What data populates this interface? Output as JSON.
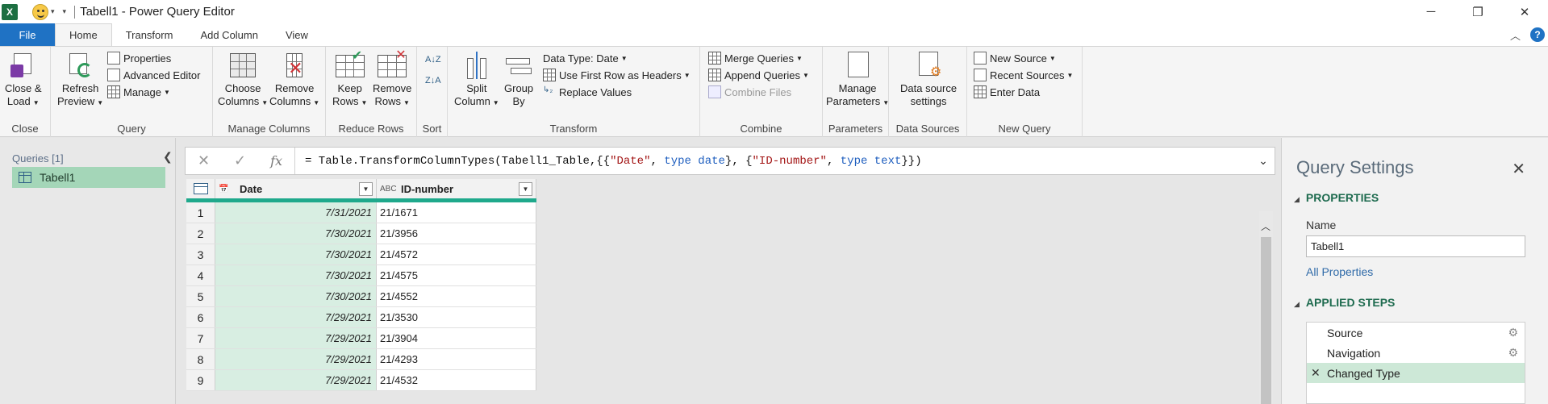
{
  "title_bar": {
    "app_icon": "excel-icon",
    "title": "Tabell1 - Power Query Editor",
    "window_controls": [
      "minimize-icon",
      "restore-icon",
      "close-icon"
    ]
  },
  "tabs": [
    {
      "label": "File"
    },
    {
      "label": "Home"
    },
    {
      "label": "Transform"
    },
    {
      "label": "Add Column"
    },
    {
      "label": "View"
    }
  ],
  "active_tab": "Home",
  "ribbon": {
    "groups": {
      "close": "Close",
      "query": "Query",
      "manage_columns": "Manage Columns",
      "reduce_rows": "Reduce Rows",
      "sort": "Sort",
      "transform": "Transform",
      "combine": "Combine",
      "parameters": "Parameters",
      "data_sources": "Data Sources",
      "new_query": "New Query"
    },
    "close_load": [
      "Close &",
      "Load"
    ],
    "refresh_preview": [
      "Refresh",
      "Preview"
    ],
    "properties": "Properties",
    "advanced_editor": "Advanced Editor",
    "manage": "Manage",
    "choose_columns": [
      "Choose",
      "Columns"
    ],
    "remove_columns": [
      "Remove",
      "Columns"
    ],
    "keep_rows": [
      "Keep",
      "Rows"
    ],
    "remove_rows": [
      "Remove",
      "Rows"
    ],
    "split_column": [
      "Split",
      "Column"
    ],
    "group_by": [
      "Group",
      "By"
    ],
    "data_type": "Data Type: Date",
    "use_first_row": "Use First Row as Headers",
    "replace_values": "Replace Values",
    "merge_queries": "Merge Queries",
    "append_queries": "Append Queries",
    "combine_files": "Combine Files",
    "manage_parameters": [
      "Manage",
      "Parameters"
    ],
    "data_source_settings": [
      "Data source",
      "settings"
    ],
    "new_source": "New Source",
    "recent_sources": "Recent Sources",
    "enter_data": "Enter Data"
  },
  "queries_pane": {
    "title": "Queries [1]",
    "items": [
      {
        "label": "Tabell1"
      }
    ]
  },
  "formula_bar": {
    "prefix": "= Table.TransformColumnTypes(Tabell1_Table,{{",
    "s1": "\"Date\"",
    "mid1": ", ",
    "kw1": "type",
    "t1": " date",
    "mid2": "}, {",
    "s2": "\"ID-number\"",
    "mid3": ", ",
    "kw2": "type",
    "t2": " text",
    "suffix": "}})"
  },
  "grid": {
    "columns": [
      {
        "type_label": "date-type-icon",
        "name": "Date"
      },
      {
        "type_label": "ABC",
        "name": "ID-number"
      }
    ],
    "rows": [
      {
        "idx": "1",
        "date": "7/31/2021",
        "id": "21/1671"
      },
      {
        "idx": "2",
        "date": "7/30/2021",
        "id": "21/3956"
      },
      {
        "idx": "3",
        "date": "7/30/2021",
        "id": "21/4572"
      },
      {
        "idx": "4",
        "date": "7/30/2021",
        "id": "21/4575"
      },
      {
        "idx": "5",
        "date": "7/30/2021",
        "id": "21/4552"
      },
      {
        "idx": "6",
        "date": "7/29/2021",
        "id": "21/3530"
      },
      {
        "idx": "7",
        "date": "7/29/2021",
        "id": "21/3904"
      },
      {
        "idx": "8",
        "date": "7/29/2021",
        "id": "21/4293"
      },
      {
        "idx": "9",
        "date": "7/29/2021",
        "id": "21/4532"
      }
    ]
  },
  "query_settings": {
    "title": "Query Settings",
    "properties_label": "PROPERTIES",
    "name_label": "Name",
    "name_value": "Tabell1",
    "all_properties": "All Properties",
    "applied_steps_label": "APPLIED STEPS",
    "steps": [
      {
        "label": "Source"
      },
      {
        "label": "Navigation"
      },
      {
        "label": "Changed Type"
      }
    ]
  },
  "colors": {
    "file_tab": "#1f72c4",
    "selected_query": "#a4d6b8",
    "column_highlight": "#d8eee2",
    "header_accent": "#1fa98c",
    "section_green": "#1e6b4f"
  }
}
